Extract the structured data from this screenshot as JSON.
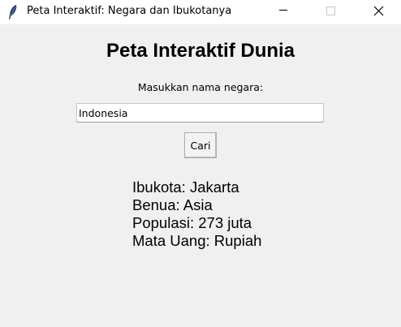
{
  "window": {
    "title": "Peta Interaktif: Negara dan Ibukotanya",
    "icon": "feather-icon",
    "controls": [
      "minimize-icon",
      "maximize-icon",
      "close-icon"
    ]
  },
  "main": {
    "heading": "Peta Interaktif Dunia",
    "prompt_label": "Masukkan nama negara:",
    "country_input": {
      "value": "Indonesia",
      "placeholder": ""
    },
    "search_button_label": "Cari",
    "result": {
      "capital": "Ibukota: Jakarta",
      "continent": "Benua: Asia",
      "population": "Populasi: 273 juta",
      "currency": "Mata Uang: Rupiah"
    }
  }
}
